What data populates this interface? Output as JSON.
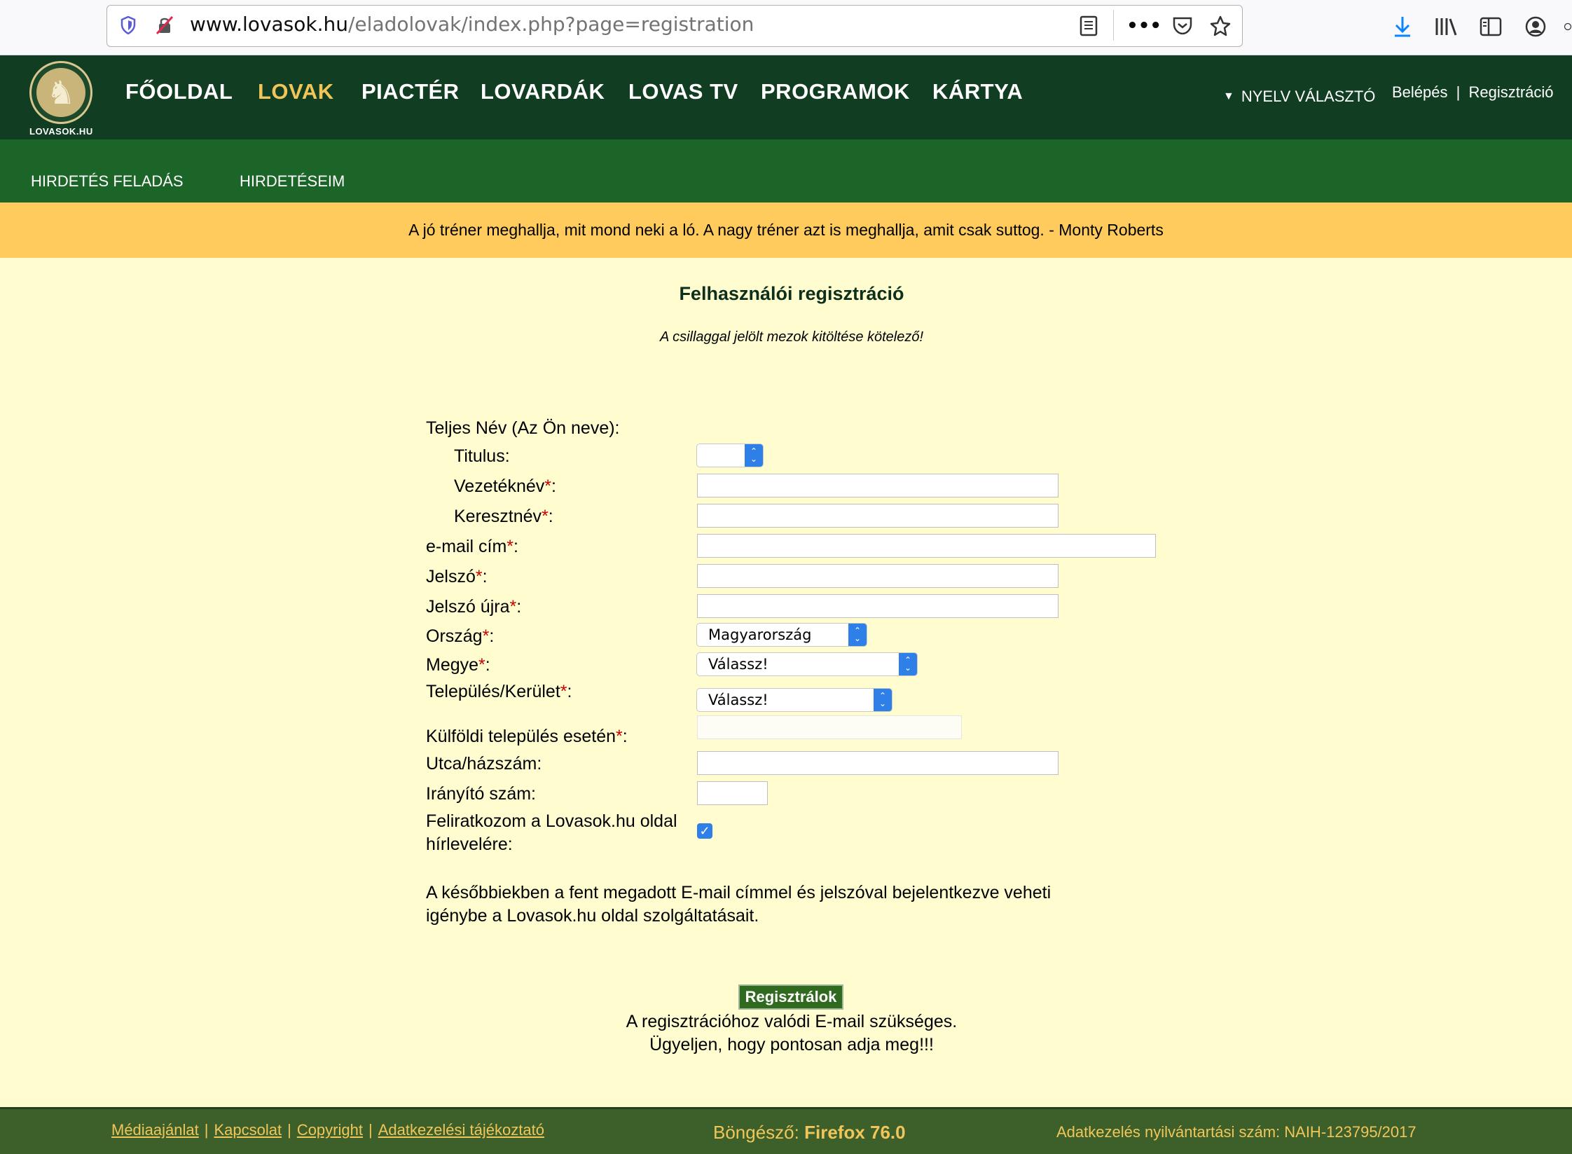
{
  "browser": {
    "url_host": "www.lovasok.hu",
    "url_path": "/eladolovak/index.php?page=registration"
  },
  "brand": {
    "logo_text": "LOVASOK.HU"
  },
  "nav": {
    "items": [
      "FŐOLDAL",
      "LOVAK",
      "PIACTÉR",
      "LOVARDÁK",
      "LOVAS TV",
      "PROGRAMOK",
      "KÁRTYA"
    ],
    "active": "LOVAK",
    "language": "NYELV VÁLASZTÓ",
    "login": "Belépés",
    "separator": "|",
    "register": "Regisztráció"
  },
  "subnav": {
    "items": [
      "HIRDETÉS FELADÁS",
      "HIRDETÉSEIM"
    ]
  },
  "quote": "A jó tréner meghallja, mit mond neki a ló. A nagy tréner azt is meghallja, amit csak suttog. - Monty Roberts",
  "form": {
    "title": "Felhasználói regisztráció",
    "subtitle": "A csillaggal jelölt mezok kitöltése kötelező!",
    "full_name_label": "Teljes Név (Az Ön neve):",
    "title_label": "Titulus:",
    "last_name_label": "Vezetéknév",
    "first_name_label": "Keresztnév",
    "email_label": "e-mail cím",
    "password_label": "Jelszó",
    "password_again_label": "Jelszó újra",
    "country_label": "Ország",
    "country_value": "Magyarország",
    "county_label": "Megye",
    "county_value": "Válassz!",
    "city_label": "Település/Kerület",
    "city_value": "Válassz!",
    "foreign_city_label": "Külföldi település esetén",
    "street_label": "Utca/házszám:",
    "zip_label": "Irányító szám:",
    "newsletter_label_1": "Feliratkozom a Lovasok.hu oldal",
    "newsletter_label_2": "hírlevelére:",
    "newsletter_checked": true,
    "required_mark": "*",
    "colon": ":",
    "info_1": "A későbbiekben a fent megadott E-mail címmel és jelszóval bejelentkezve veheti",
    "info_2": "igénybe a Lovasok.hu oldal szolgáltatásait.",
    "submit": "Regisztrálok",
    "note_1": "A regisztrációhoz valódi E-mail szükséges.",
    "note_2": "Ügyeljen, hogy pontosan adja meg!!!"
  },
  "footer": {
    "links": [
      "Médiaajánlat",
      "Kapcsolat",
      "Copyright",
      "Adatkezelési tájékoztató"
    ],
    "browser_label": "Böngésző:",
    "browser_value": "Firefox 76.0",
    "naih": "Adatkezelés nyilvántartási szám: NAIH-123795/2017"
  },
  "colors": {
    "nav_bg": "#113d22",
    "subnav_bg": "#1a6527",
    "accent": "#f0c65a",
    "quote_bg": "#ffcb5c",
    "page_bg": "#fffdd0"
  }
}
